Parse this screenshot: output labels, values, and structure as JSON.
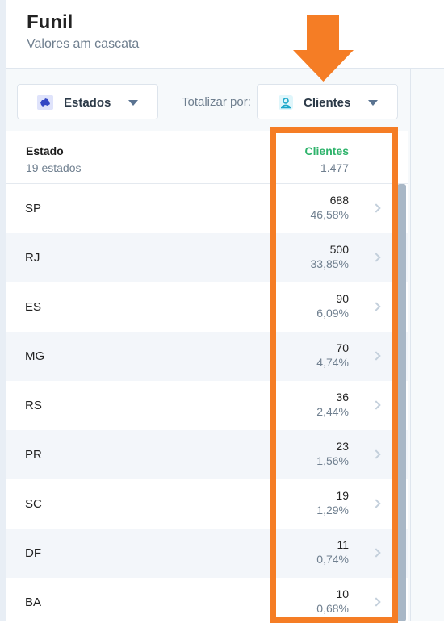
{
  "header": {
    "title": "Funil",
    "subtitle": "Valores am cascata"
  },
  "toolbar": {
    "group_selector": {
      "label": "Estados",
      "icon": "map-region-icon"
    },
    "total_label": "Totalizar por:",
    "metric_selector": {
      "label": "Clientes",
      "icon": "user-icon"
    }
  },
  "table": {
    "header": {
      "dimension": "Estado",
      "count": "19 estados",
      "metric": "Clientes",
      "total": "1.477"
    },
    "rows": [
      {
        "state": "SP",
        "value": "688",
        "percent": "46,58%"
      },
      {
        "state": "RJ",
        "value": "500",
        "percent": "33,85%"
      },
      {
        "state": "ES",
        "value": "90",
        "percent": "6,09%"
      },
      {
        "state": "MG",
        "value": "70",
        "percent": "4,74%"
      },
      {
        "state": "RS",
        "value": "36",
        "percent": "2,44%"
      },
      {
        "state": "PR",
        "value": "23",
        "percent": "1,56%"
      },
      {
        "state": "SC",
        "value": "19",
        "percent": "1,29%"
      },
      {
        "state": "DF",
        "value": "11",
        "percent": "0,74%"
      },
      {
        "state": "BA",
        "value": "10",
        "percent": "0,68%"
      }
    ]
  },
  "colors": {
    "accent_green": "#2eb36b",
    "annotation_orange": "#f57d25"
  }
}
